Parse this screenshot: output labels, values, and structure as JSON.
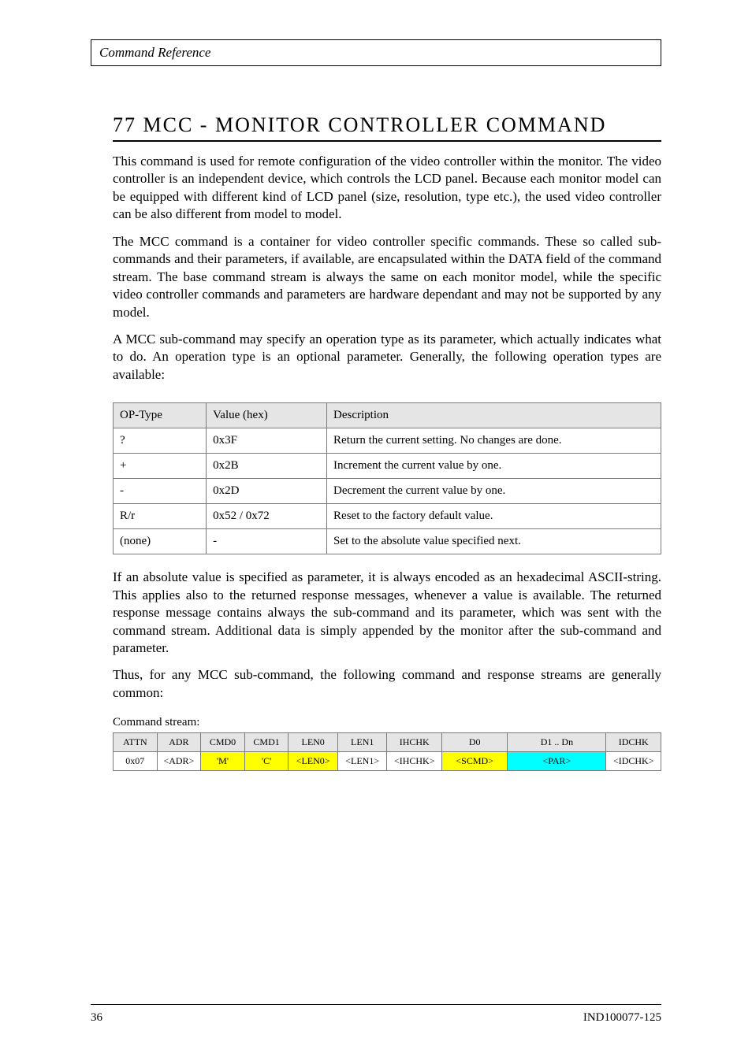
{
  "header": {
    "title": "Command Reference"
  },
  "section": {
    "title": "77 MCC - MONITOR CONTROLLER COMMAND"
  },
  "para": {
    "p1": "This command is used for remote configuration of the video controller within the monitor. The video controller is an independent device, which controls the LCD panel. Because each monitor model can be equipped with different kind of LCD panel (size, resolution, type etc.), the used video controller can be also different from model to model.",
    "p2": "The MCC command is a container for video controller specific commands. These so called sub-commands and their parameters, if available, are encapsulated within the DATA field of the command stream. The base command stream is always the same on each monitor model, while the specific video controller commands and parameters are hardware dependant and may not be supported by any model.",
    "p3": "A MCC sub-command may specify an operation type as its parameter, which actually indicates what to do. An operation type is an optional parameter. Generally, the following operation types are available:",
    "p4": "If an absolute value is specified as parameter, it is always encoded as an hexadecimal ASCII-string. This applies also to the returned response messages, whenever a value is available. The returned response message contains always the sub-command and its parameter, which was sent with the command stream. Additional data is simply appended by the monitor after the sub-command and parameter.",
    "p5": "Thus, for any MCC sub-command, the following command and response streams are generally common:"
  },
  "op_table": {
    "hdr": {
      "c1": "OP-Type",
      "c2": "Value (hex)",
      "c3": "Description"
    },
    "rows": [
      {
        "c1": "?",
        "c2": "0x3F",
        "c3": "Return the current setting. No changes are done."
      },
      {
        "c1": "+",
        "c2": "0x2B",
        "c3": "Increment the current value by one."
      },
      {
        "c1": "-",
        "c2": "0x2D",
        "c3": "Decrement the current value by one."
      },
      {
        "c1": "R/r",
        "c2": "0x52 / 0x72",
        "c3": "Reset to the factory default value."
      },
      {
        "c1": "(none)",
        "c2": "-",
        "c3": "Set to the absolute value specified next."
      }
    ]
  },
  "stream": {
    "label": "Command stream:",
    "hdr": [
      "ATTN",
      "ADR",
      "CMD0",
      "CMD1",
      "LEN0",
      "LEN1",
      "IHCHK",
      "D0",
      "D1 .. Dn",
      "IDCHK"
    ],
    "row": [
      "0x07",
      "<ADR>",
      "'M'",
      "'C'",
      "<LEN0>",
      "<LEN1>",
      "<IHCHK>",
      "<SCMD>",
      "<PAR>",
      "<IDCHK>"
    ],
    "yellow_idx": [
      2,
      3,
      4,
      7
    ],
    "cyan_idx": [
      8
    ]
  },
  "footer": {
    "page": "36",
    "right": "IND100077-125"
  }
}
